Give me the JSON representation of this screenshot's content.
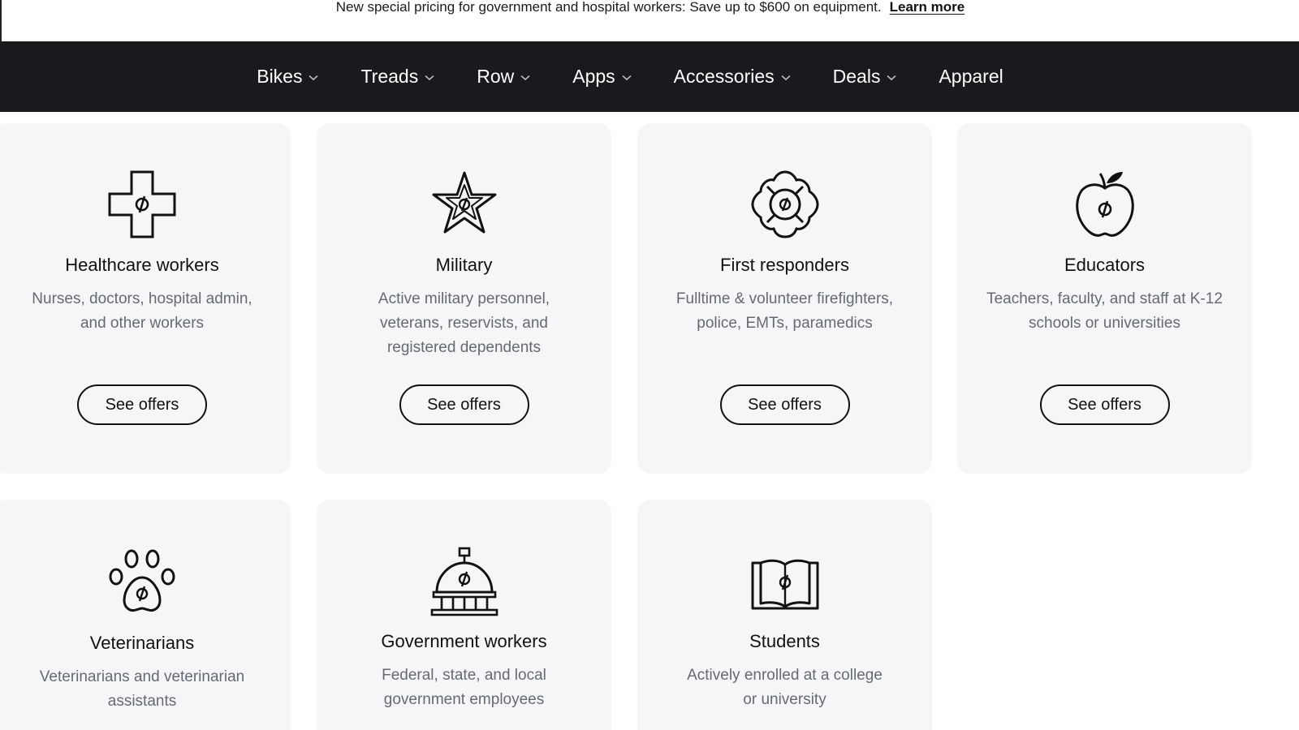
{
  "banner": {
    "text": "New special pricing for government and hospital workers: Save up to $600 on equipment.",
    "link": "Learn more"
  },
  "nav": {
    "items": [
      {
        "label": "Bikes",
        "dropdown": true
      },
      {
        "label": "Treads",
        "dropdown": true
      },
      {
        "label": "Row",
        "dropdown": true
      },
      {
        "label": "Apps",
        "dropdown": true
      },
      {
        "label": "Accessories",
        "dropdown": true
      },
      {
        "label": "Deals",
        "dropdown": true
      },
      {
        "label": "Apparel",
        "dropdown": false
      }
    ]
  },
  "cards": [
    {
      "title": "Healthcare workers",
      "desc": "Nurses, doctors, hospital admin, and other workers",
      "button": "See offers",
      "icon": "medical-cross-icon"
    },
    {
      "title": "Military",
      "desc": "Active military personnel, veterans, reservists, and registered dependents",
      "button": "See offers",
      "icon": "star-badge-icon"
    },
    {
      "title": "First responders",
      "desc": "Fulltime & volunteer firefighters, police, EMTs, paramedics",
      "button": "See offers",
      "icon": "fire-badge-icon"
    },
    {
      "title": "Educators",
      "desc": "Teachers, faculty, and staff at K-12 schools or universities",
      "button": "See offers",
      "icon": "apple-icon"
    },
    {
      "title": "Veterinarians",
      "desc": "Veterinarians and veterinarian assistants",
      "button": "",
      "icon": "paw-icon"
    },
    {
      "title": "Government workers",
      "desc": "Federal, state, and local government employees",
      "button": "",
      "icon": "capitol-icon"
    },
    {
      "title": "Students",
      "desc": "Actively enrolled at a college or university",
      "button": "",
      "icon": "book-icon"
    }
  ],
  "colors": {
    "nav_bg": "#181a1d",
    "card_bg": "#f5f6f8",
    "desc_text": "#666a70"
  }
}
